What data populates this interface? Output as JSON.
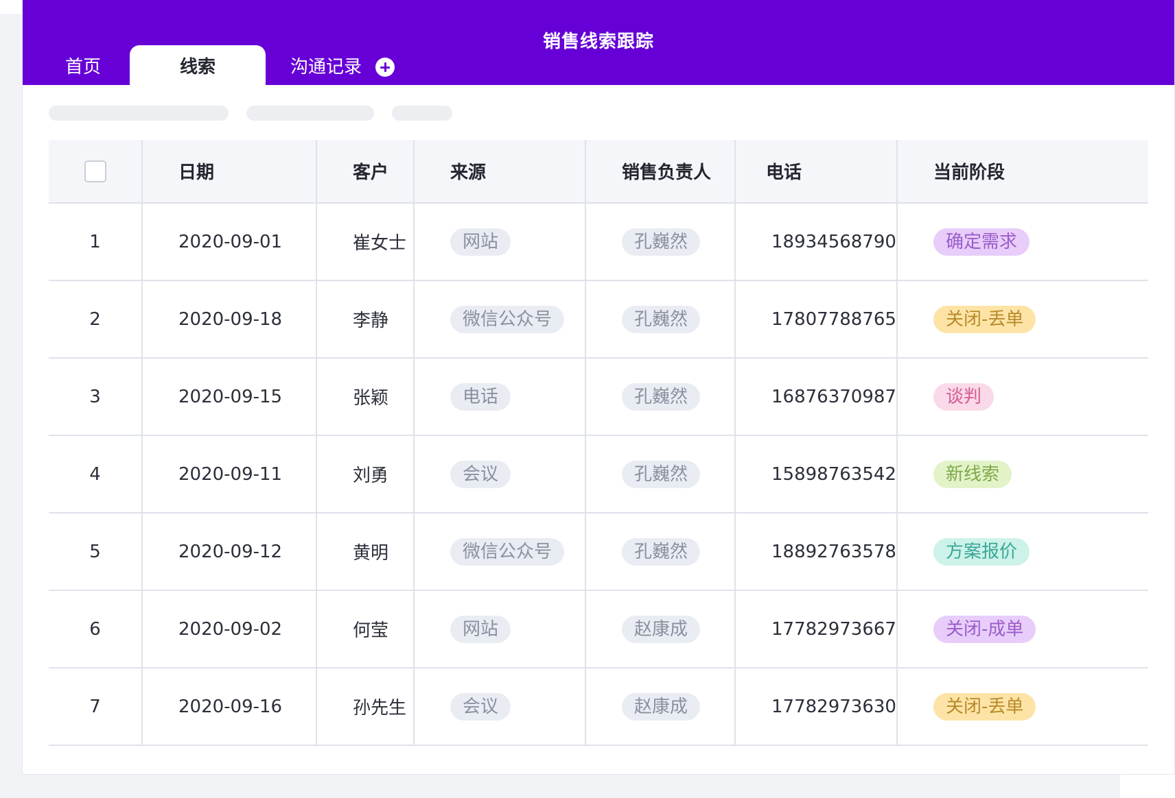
{
  "app": {
    "title": "销售线索跟踪"
  },
  "tabs": [
    {
      "label": "首页",
      "active": false
    },
    {
      "label": "线索",
      "active": true
    },
    {
      "label": "沟通记录",
      "active": false
    }
  ],
  "table": {
    "columns": [
      "日期",
      "客户",
      "来源",
      "销售负责人",
      "电话",
      "当前阶段"
    ],
    "rows": [
      {
        "num": "1",
        "date": "2020-09-01",
        "customer": "崔女士",
        "source": "网站",
        "owner": "孔巍然",
        "phone": "18934568790",
        "stage": "确定需求",
        "stage_color": "#e8cdfa"
      },
      {
        "num": "2",
        "date": "2020-09-18",
        "customer": "李静",
        "source": "微信公众号",
        "owner": "孔巍然",
        "phone": "17807788765",
        "stage": "关闭-丢单",
        "stage_color": "#fde4a6"
      },
      {
        "num": "3",
        "date": "2020-09-15",
        "customer": "张颖",
        "source": "电话",
        "owner": "孔巍然",
        "phone": "16876370987",
        "stage": "谈判",
        "stage_color": "#fad9e8"
      },
      {
        "num": "4",
        "date": "2020-09-11",
        "customer": "刘勇",
        "source": "会议",
        "owner": "孔巍然",
        "phone": "15898763542",
        "stage": "新线索",
        "stage_color": "#e2f3c8"
      },
      {
        "num": "5",
        "date": "2020-09-12",
        "customer": "黄明",
        "source": "微信公众号",
        "owner": "孔巍然",
        "phone": "18892763578",
        "stage": "方案报价",
        "stage_color": "#cdf2ea"
      },
      {
        "num": "6",
        "date": "2020-09-02",
        "customer": "何莹",
        "source": "网站",
        "owner": "赵康成",
        "phone": "17782973667",
        "stage": "关闭-成单",
        "stage_color": "#e8cdfa"
      },
      {
        "num": "7",
        "date": "2020-09-16",
        "customer": "孙先生",
        "source": "会议",
        "owner": "赵康成",
        "phone": "17782973630",
        "stage": "关闭-丢单",
        "stage_color": "#fde4a6"
      }
    ]
  },
  "colors": {
    "brand": "#6600d6",
    "header_bg": "#f5f6fa",
    "border": "#dfe2ea"
  },
  "icons": {
    "add_tab": "plus-circle-icon",
    "select_all": "checkbox-icon"
  }
}
